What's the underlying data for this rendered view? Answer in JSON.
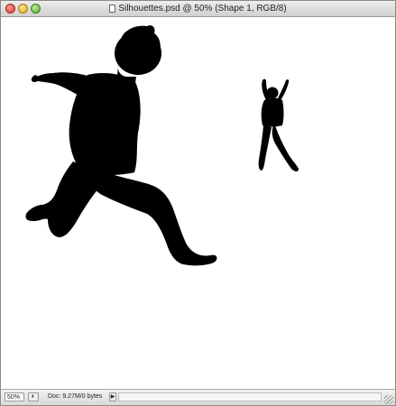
{
  "window": {
    "title": "Silhouettes.psd @ 50% (Shape 1, RGB/8)"
  },
  "titlebar": {
    "close_icon": "close-icon",
    "minimize_icon": "minimize-icon",
    "zoom_icon": "zoom-icon",
    "document_icon": "document-icon"
  },
  "canvas": {
    "background": "#ffffff",
    "silhouette_color": "#000000"
  },
  "statusbar": {
    "zoom_level": "50%",
    "doc_info": "Doc: 9.27M/0 bytes",
    "arrow": "▶",
    "screen_mode_icon": "screen-mode-icon"
  }
}
